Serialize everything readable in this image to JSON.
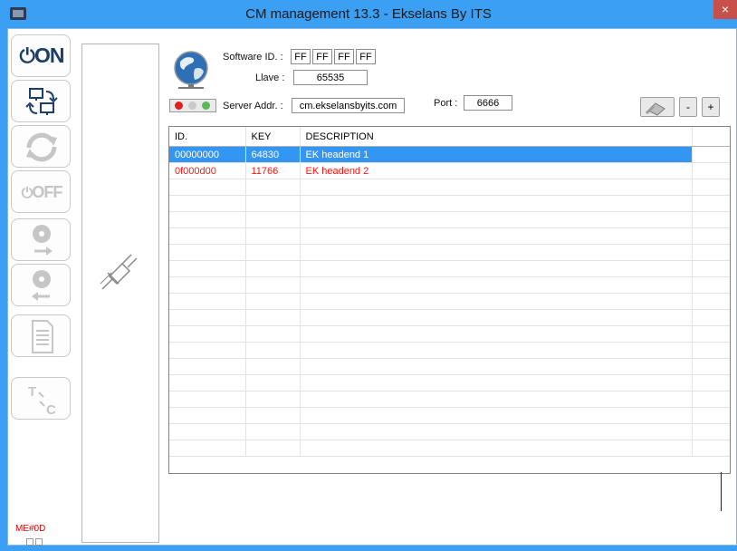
{
  "window": {
    "title": "CM management 13.3 - Ekselans By ITS",
    "close_label": "×"
  },
  "toolbar": {
    "on_label": "ON",
    "off_label": "OFF",
    "buttons": [
      {
        "name": "connect-on-button",
        "icon": "power-on-icon",
        "enabled": true
      },
      {
        "name": "transfer-button",
        "icon": "computers-swap-icon",
        "enabled": true
      },
      {
        "name": "refresh-button",
        "icon": "refresh-icon",
        "enabled": false
      },
      {
        "name": "off-button",
        "icon": "power-off-icon",
        "enabled": false
      },
      {
        "name": "disc-export-button",
        "icon": "disc-arrow-right-icon",
        "enabled": false
      },
      {
        "name": "disc-import-button",
        "icon": "disc-arrow-left-icon",
        "enabled": false
      },
      {
        "name": "document-button",
        "icon": "document-icon",
        "enabled": false
      },
      {
        "name": "translate-button",
        "icon": "t-to-c-icon",
        "enabled": false
      }
    ]
  },
  "status": {
    "code": "ME#0D"
  },
  "header": {
    "software_id_label": "Software ID. :",
    "software_id": [
      "FF",
      "FF",
      "FF",
      "FF"
    ],
    "llave_label": "Llave :",
    "llave_value": "65535",
    "server_label": "Server Addr. :",
    "server_value": "cm.ekselansbyits.com",
    "port_label": "Port :",
    "port_value": "6666",
    "minus_label": "-",
    "plus_label": "+",
    "led_colors": [
      "#e02020",
      "#c9c9c9",
      "#5cb85c"
    ]
  },
  "table": {
    "columns": [
      "ID.",
      "KEY",
      "DESCRIPTION",
      ""
    ],
    "rows": [
      {
        "id": "00000000",
        "key": "64830",
        "description": "EK headend 1",
        "state": "selected"
      },
      {
        "id": "0f000d00",
        "key": "11766",
        "description": "EK headend 2",
        "state": "red"
      }
    ],
    "empty_rows": 17
  },
  "colors": {
    "selection": "#3396f2",
    "error_text": "#ff1414",
    "title_bar": "#3b9ff3"
  }
}
